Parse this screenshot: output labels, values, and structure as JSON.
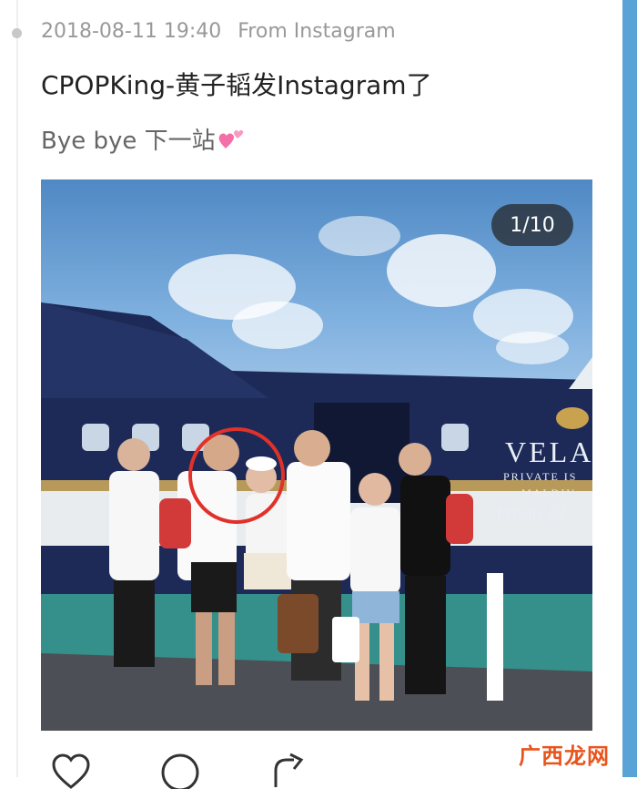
{
  "post": {
    "date": "2018-08-11 19:40",
    "source": "From Instagram",
    "title": "CPOPKing-黄子韬发Instagram了",
    "caption": "Bye bye 下一站",
    "caption_emoji": "two-hearts-icon"
  },
  "gallery": {
    "counter": "1/10",
    "plane_livery": {
      "brand": "VELA",
      "line1": "PRIVATE IS",
      "line2": "MALDIV",
      "script": "Private Isl"
    }
  },
  "actions": [
    "heart-icon",
    "comment-icon",
    "share-icon"
  ],
  "watermark": "广西龙网",
  "colors": {
    "accent_circle": "#e0312b",
    "watermark": "#e8541c",
    "plane_body": "#1d2a57"
  }
}
